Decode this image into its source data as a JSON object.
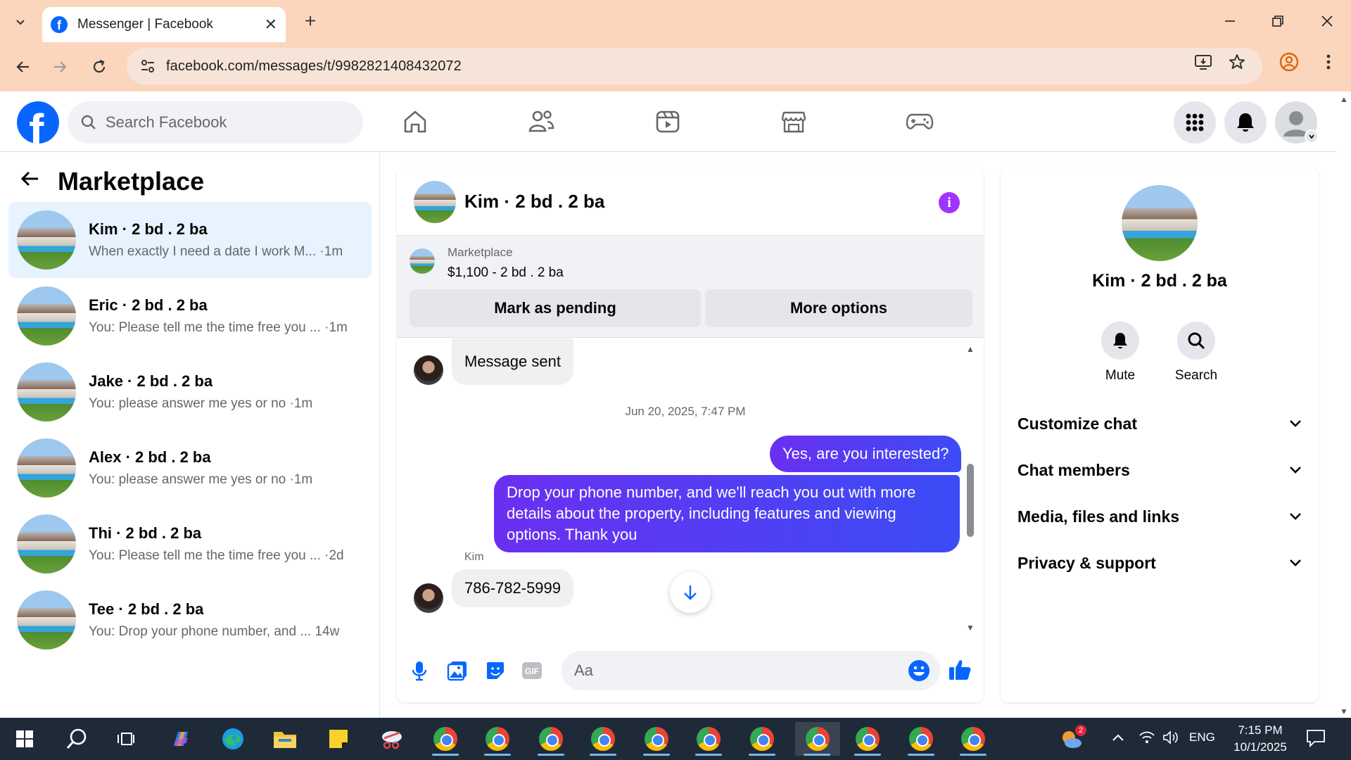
{
  "browser": {
    "tab_title": "Messenger | Facebook",
    "url": "facebook.com/messages/t/9982821408432072"
  },
  "fb": {
    "search_placeholder": "Search Facebook"
  },
  "sidebar": {
    "title": "Marketplace",
    "conversations": [
      {
        "name": "Kim · 2 bd . 2 ba",
        "snippet": "When exactly I need a date I work M... ·1m",
        "active": true
      },
      {
        "name": "Eric · 2 bd . 2 ba",
        "snippet": "You: Please tell me the time free you ... ·1m"
      },
      {
        "name": "Jake · 2 bd . 2 ba",
        "snippet": "You: please answer me yes or no ·1m"
      },
      {
        "name": "Alex · 2 bd . 2 ba",
        "snippet": "You: please answer me yes or no ·1m"
      },
      {
        "name": "Thi · 2 bd . 2 ba",
        "snippet": "You: Please tell me the time free you ... ·2d"
      },
      {
        "name": "Tee · 2 bd . 2 ba",
        "snippet": "You: Drop your phone number, and ... 14w"
      }
    ]
  },
  "chat": {
    "title": "Kim · 2 bd . 2 ba",
    "marketplace_label": "Marketplace",
    "listing": "$1,100 - 2 bd . 2 ba",
    "mark_pending": "Mark as pending",
    "more_options": "More options",
    "messages": {
      "sent_notice": "Message sent",
      "timestamp": "Jun 20, 2025, 7:47 PM",
      "out1": "Yes, are you interested?",
      "out2": "Drop your phone number, and we'll reach you out with more details about the property, including features and viewing options.  Thank you",
      "sender": "Kim",
      "in_phone": "786-782-5999"
    },
    "composer_placeholder": "Aa"
  },
  "details": {
    "name": "Kim · 2 bd . 2 ba",
    "mute": "Mute",
    "search": "Search",
    "sections": [
      "Customize chat",
      "Chat members",
      "Media, files and links",
      "Privacy & support"
    ]
  },
  "taskbar": {
    "lang": "ENG",
    "time": "7:15 PM",
    "date": "10/1/2025",
    "weather_badge": "2"
  },
  "colors": {
    "fb_blue": "#0866ff",
    "outgoing_bubble": "#5b3bf3",
    "chrome_frame": "#fbd6bd"
  }
}
